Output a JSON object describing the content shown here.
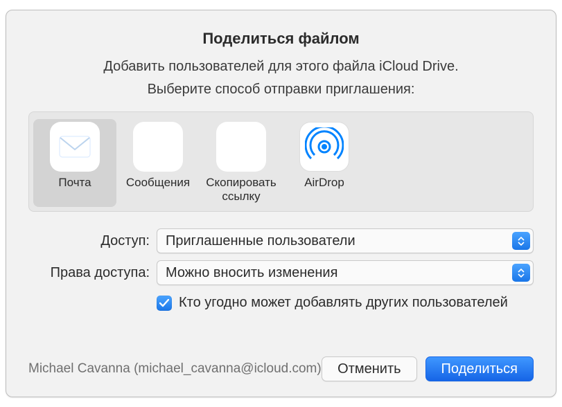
{
  "title": "Поделиться файлом",
  "subtitle": "Добавить пользователей для этого файла iCloud Drive.",
  "instruction": "Выберите способ отправки приглашения:",
  "methods": [
    {
      "label": "Почта",
      "selected": true
    },
    {
      "label": "Сообщения",
      "selected": false
    },
    {
      "label": "Скопировать ссылку",
      "selected": false
    },
    {
      "label": "AirDrop",
      "selected": false
    }
  ],
  "settings": {
    "access_label": "Доступ:",
    "access_value": "Приглашенные пользователи",
    "permission_label": "Права доступа:",
    "permission_value": "Можно вносить изменения",
    "checkbox_label": "Кто угодно может добавлять других пользователей",
    "checkbox_checked": true
  },
  "account": "Michael Cavanna (michael_cavanna@icloud.com)",
  "buttons": {
    "cancel": "Отменить",
    "share": "Поделиться"
  }
}
